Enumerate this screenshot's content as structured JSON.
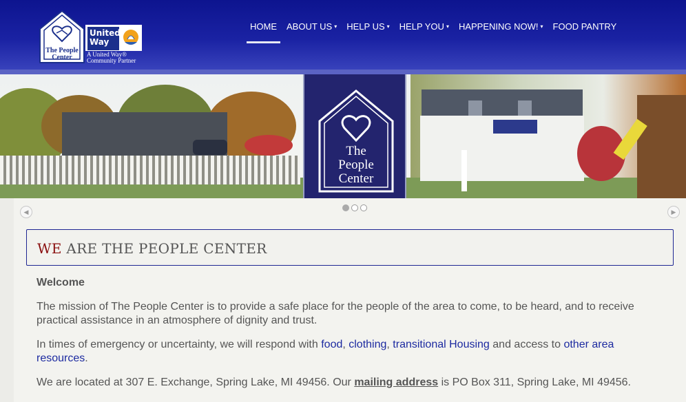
{
  "logo": {
    "house_text_line1": "The People",
    "house_text_line2": "Center",
    "uw_line1": "United",
    "uw_line2": "Way",
    "uw_sub_line1": "A United Way®",
    "uw_sub_line2": "Community Partner"
  },
  "nav": {
    "items": [
      {
        "label": "HOME",
        "dropdown": false,
        "active": true
      },
      {
        "label": "ABOUT US",
        "dropdown": true,
        "active": false
      },
      {
        "label": "HELP US",
        "dropdown": true,
        "active": false
      },
      {
        "label": "HELP YOU",
        "dropdown": true,
        "active": false
      },
      {
        "label": "HAPPENING NOW!",
        "dropdown": true,
        "active": false
      },
      {
        "label": "FOOD PANTRY",
        "dropdown": false,
        "active": false
      }
    ],
    "caret": "▾"
  },
  "banner": {
    "sign_line1": "The",
    "sign_line2": "People",
    "sign_line3": "Center"
  },
  "slider": {
    "prev_glyph": "◀",
    "next_glyph": "▶",
    "slide_count": 3,
    "current_slide": 1
  },
  "main": {
    "title_first": "WE",
    "title_rest": " ARE THE PEOPLE CENTER",
    "welcome": "Welcome",
    "p1": "The mission of The People Center is to provide a safe place for the people of the area to come, to be heard, and to receive practical assistance in an atmosphere of dignity and trust.",
    "p2_prefix": "In times of emergency or uncertainty, we will respond with ",
    "p2_link_food": "food",
    "p2_sep1": ", ",
    "p2_link_clothing": "clothing",
    "p2_sep2": ", ",
    "p2_link_housing": "transitional Housing",
    "p2_mid": " and access to ",
    "p2_link_resources": "other area resources",
    "p2_end": ".",
    "p3_prefix": "We are located at 307 E. Exchange, Spring Lake, MI 49456.  Our ",
    "p3_link": "mailing address",
    "p3_suffix": " is PO Box 311, Spring Lake, MI 49456."
  },
  "colors": {
    "header_blue": "#0d148f",
    "title_border": "#1d2592",
    "title_accent": "#8a1010",
    "link_blue": "#1c2aa0"
  }
}
